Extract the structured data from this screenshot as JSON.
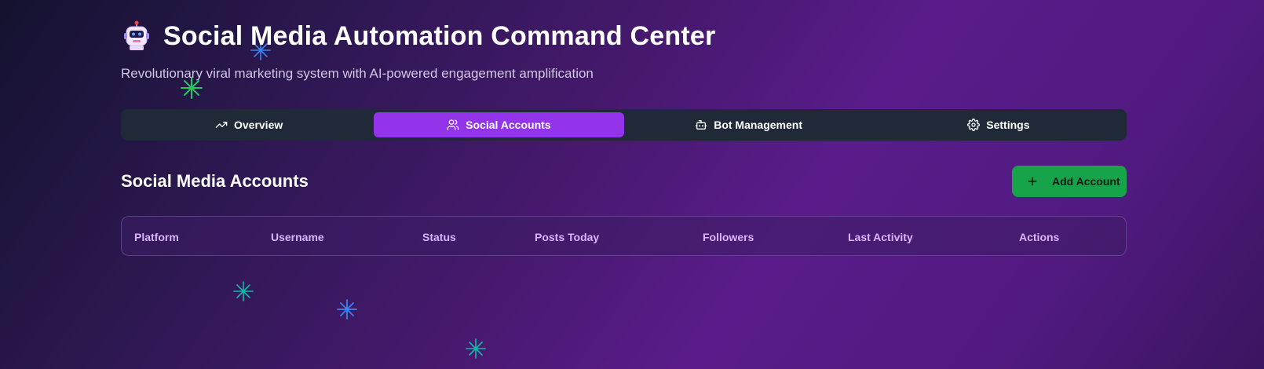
{
  "header": {
    "icon": "robot-icon",
    "title": "Social Media Automation Command Center",
    "subtitle": "Revolutionary viral marketing system with AI-powered engagement amplification"
  },
  "tabs": [
    {
      "label": "Overview",
      "icon": "trending-up-icon",
      "active": false
    },
    {
      "label": "Social Accounts",
      "icon": "users-icon",
      "active": true
    },
    {
      "label": "Bot Management",
      "icon": "bot-icon",
      "active": false
    },
    {
      "label": "Settings",
      "icon": "gear-icon",
      "active": false
    }
  ],
  "accounts": {
    "title": "Social Media Accounts",
    "add_button_label": "Add Account",
    "add_button_icon": "plus-icon",
    "columns": [
      "Platform",
      "Username",
      "Status",
      "Posts Today",
      "Followers",
      "Last Activity",
      "Actions"
    ],
    "rows": []
  },
  "colors": {
    "accent": "#9333ea",
    "add_button": "#16a34a",
    "tabbar": "#1f2937",
    "column_header": "#d8b4fe"
  }
}
